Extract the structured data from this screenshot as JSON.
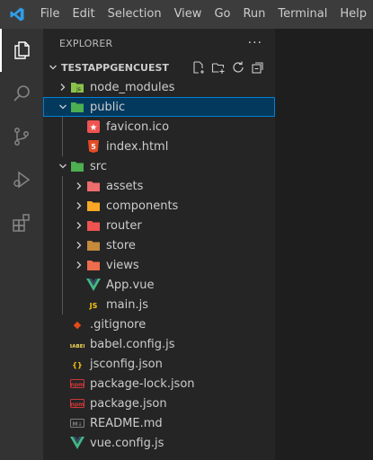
{
  "menu": [
    "File",
    "Edit",
    "Selection",
    "View",
    "Go",
    "Run",
    "Terminal",
    "Help"
  ],
  "explorer": {
    "title": "EXPLORER",
    "more": "···",
    "project": "TESTAPPGENCUEST"
  },
  "tree": [
    {
      "label": "node_modules",
      "depth": 0,
      "kind": "folder",
      "expanded": false,
      "icon": "node-folder-icon"
    },
    {
      "label": "public",
      "depth": 0,
      "kind": "folder",
      "expanded": true,
      "icon": "public-folder-icon",
      "selected": true
    },
    {
      "label": "favicon.ico",
      "depth": 1,
      "kind": "file",
      "icon": "favicon-file-icon"
    },
    {
      "label": "index.html",
      "depth": 1,
      "kind": "file",
      "icon": "html-file-icon"
    },
    {
      "label": "src",
      "depth": 0,
      "kind": "folder",
      "expanded": true,
      "icon": "src-folder-icon"
    },
    {
      "label": "assets",
      "depth": 1,
      "kind": "folder",
      "expanded": false,
      "icon": "assets-folder-icon"
    },
    {
      "label": "components",
      "depth": 1,
      "kind": "folder",
      "expanded": false,
      "icon": "components-folder-icon"
    },
    {
      "label": "router",
      "depth": 1,
      "kind": "folder",
      "expanded": false,
      "icon": "router-folder-icon"
    },
    {
      "label": "store",
      "depth": 1,
      "kind": "folder",
      "expanded": false,
      "icon": "store-folder-icon"
    },
    {
      "label": "views",
      "depth": 1,
      "kind": "folder",
      "expanded": false,
      "icon": "views-folder-icon"
    },
    {
      "label": "App.vue",
      "depth": 1,
      "kind": "file",
      "icon": "vue-file-icon"
    },
    {
      "label": "main.js",
      "depth": 1,
      "kind": "file",
      "icon": "js-file-icon"
    },
    {
      "label": ".gitignore",
      "depth": 0,
      "kind": "file",
      "icon": "git-file-icon"
    },
    {
      "label": "babel.config.js",
      "depth": 0,
      "kind": "file",
      "icon": "babel-file-icon"
    },
    {
      "label": "jsconfig.json",
      "depth": 0,
      "kind": "file",
      "icon": "json-file-icon"
    },
    {
      "label": "package-lock.json",
      "depth": 0,
      "kind": "file",
      "icon": "npm-file-icon"
    },
    {
      "label": "package.json",
      "depth": 0,
      "kind": "file",
      "icon": "npm-file-icon"
    },
    {
      "label": "README.md",
      "depth": 0,
      "kind": "file",
      "icon": "markdown-file-icon"
    },
    {
      "label": "vue.config.js",
      "depth": 0,
      "kind": "file",
      "icon": "vue-config-file-icon"
    }
  ],
  "icons": {
    "node-folder-icon": {
      "text": "js",
      "color": "#8bc34a",
      "shape": "folder"
    },
    "public-folder-icon": {
      "text": "",
      "color": "#4caf50",
      "shape": "folder"
    },
    "src-folder-icon": {
      "text": "",
      "color": "#4caf50",
      "shape": "folder"
    },
    "assets-folder-icon": {
      "text": "",
      "color": "#ef6c6c",
      "shape": "folder"
    },
    "components-folder-icon": {
      "text": "",
      "color": "#f9a825",
      "shape": "folder"
    },
    "router-folder-icon": {
      "text": "",
      "color": "#ef5350",
      "shape": "folder"
    },
    "store-folder-icon": {
      "text": "",
      "color": "#c68a3b",
      "shape": "folder"
    },
    "views-folder-icon": {
      "text": "",
      "color": "#ef6c4c",
      "shape": "folder"
    },
    "favicon-file-icon": {
      "text": "★",
      "color": "#ef5350",
      "shape": "badge"
    },
    "html-file-icon": {
      "text": "5",
      "color": "#e44d26",
      "shape": "shield"
    },
    "vue-file-icon": {
      "text": "",
      "color": "#41b883",
      "shape": "vue"
    },
    "js-file-icon": {
      "text": "JS",
      "color": "#f1c40f",
      "shape": "text"
    },
    "git-file-icon": {
      "text": "◆",
      "color": "#e64a19",
      "shape": "text"
    },
    "babel-file-icon": {
      "text": "BABEL",
      "color": "#f5da55",
      "shape": "text"
    },
    "json-file-icon": {
      "text": "{}",
      "color": "#f1c40f",
      "shape": "text"
    },
    "npm-file-icon": {
      "text": "npm",
      "color": "#cb3837",
      "shape": "box"
    },
    "markdown-file-icon": {
      "text": "M↓",
      "color": "#7e7e7e",
      "shape": "box"
    },
    "vue-config-file-icon": {
      "text": "",
      "color": "#41b883",
      "shape": "vue"
    }
  },
  "colors": {
    "accent_blue": "#007fd4",
    "selection": "#04395e",
    "titlebar": "#3c3c3c",
    "activitybar": "#333333",
    "sidebar": "#252526"
  }
}
